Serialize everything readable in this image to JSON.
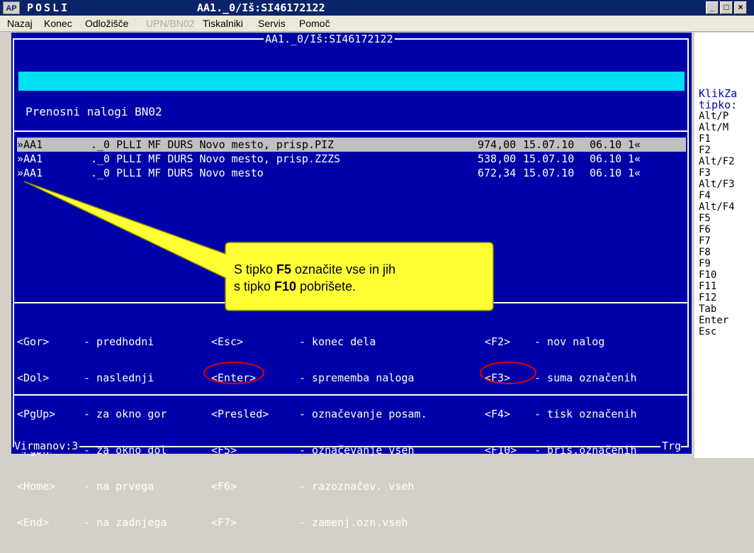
{
  "window": {
    "app_icon_text": "AP",
    "app_name": "POSLI",
    "title": "AA1._0/Iš:SI46172122"
  },
  "menu": [
    {
      "label": "Nazaj",
      "disabled": false
    },
    {
      "label": "Konec",
      "disabled": false
    },
    {
      "label": "Odložišče",
      "disabled": false
    },
    {
      "label": "UPN/BN02",
      "disabled": true
    },
    {
      "label": "Tiskalniki",
      "disabled": false
    },
    {
      "label": "Servis",
      "disabled": false
    },
    {
      "label": "Pomoč",
      "disabled": false
    }
  ],
  "console": {
    "frame_title": "AA1._0/Iš:SI46172122",
    "section_title": "Prenosni nalogi BN02",
    "rows": [
      {
        "id": "»AA1",
        "desc": "._0 PLLI MF DURS Novo mesto, prisp.PIZ",
        "amount": "974,00",
        "date": "15.07.10",
        "time": "06.10",
        "flag": "1«",
        "selected": true
      },
      {
        "id": "»AA1",
        "desc": "._0 PLLI MF DURS Novo mesto, prisp.ZZZS",
        "amount": "538,00",
        "date": "15.07.10",
        "time": "06.10",
        "flag": "1«",
        "selected": false
      },
      {
        "id": "»AA1",
        "desc": "._0 PLLI MF DURS Novo mesto",
        "amount": "672,34",
        "date": "15.07.10",
        "time": "06.10",
        "flag": "1«",
        "selected": false
      }
    ],
    "help_col1": [
      {
        "key": "<Gor>",
        "desc": "- predhodni"
      },
      {
        "key": "<Dol>",
        "desc": "- naslednji"
      },
      {
        "key": "<PgUp>",
        "desc": "- za okno gor"
      },
      {
        "key": "<PgDn>",
        "desc": "- za okno dol"
      },
      {
        "key": "<Home>",
        "desc": "- na prvega"
      },
      {
        "key": "<End>",
        "desc": "- na zadnjega"
      }
    ],
    "help_col2": [
      {
        "key": "<Esc>",
        "desc": "- konec dela"
      },
      {
        "key": "<Enter>",
        "desc": "- sprememba naloga"
      },
      {
        "key": "<Presled>",
        "desc": "- označevanje posam."
      },
      {
        "key": "<F5>",
        "desc": "- označevanje vseh"
      },
      {
        "key": "<F6>",
        "desc": "- razoznačev. vseh"
      },
      {
        "key": "<F7>",
        "desc": "- zamenj.ozn.vseh"
      }
    ],
    "help_col3": [
      {
        "key": "<F2>",
        "desc": "- nov nalog"
      },
      {
        "key": "<F3>",
        "desc": "- suma označenih"
      },
      {
        "key": "<F4>",
        "desc": "- tisk označenih"
      },
      {
        "key": "<F10>",
        "desc": "- bris.označenih"
      }
    ],
    "footer_left": "Virmanov:3",
    "footer_right": "Trg"
  },
  "side_panel": {
    "title_lines": [
      "KlikZa",
      "tipko:"
    ],
    "keys": [
      "Alt/P",
      "Alt/M",
      "F1",
      "F2",
      "Alt/F2",
      "F3",
      "Alt/F3",
      "F4",
      "Alt/F4",
      "F5",
      "F6",
      "F7",
      "F8",
      "F9",
      "F10",
      "F11",
      "F12",
      "Tab",
      "Enter",
      "Esc"
    ]
  },
  "callout": {
    "line1_pre": "S tipko ",
    "line1_key": "F5",
    "line1_post": " označite vse in jih",
    "line2_pre": "s tipko ",
    "line2_key": "F10",
    "line2_post": " pobrišete."
  },
  "colors": {
    "console_bg": "#0000a8",
    "cyan_bar": "#00e0f0",
    "callout_bg": "#ffff33",
    "highlight_oval": "#e00000"
  }
}
